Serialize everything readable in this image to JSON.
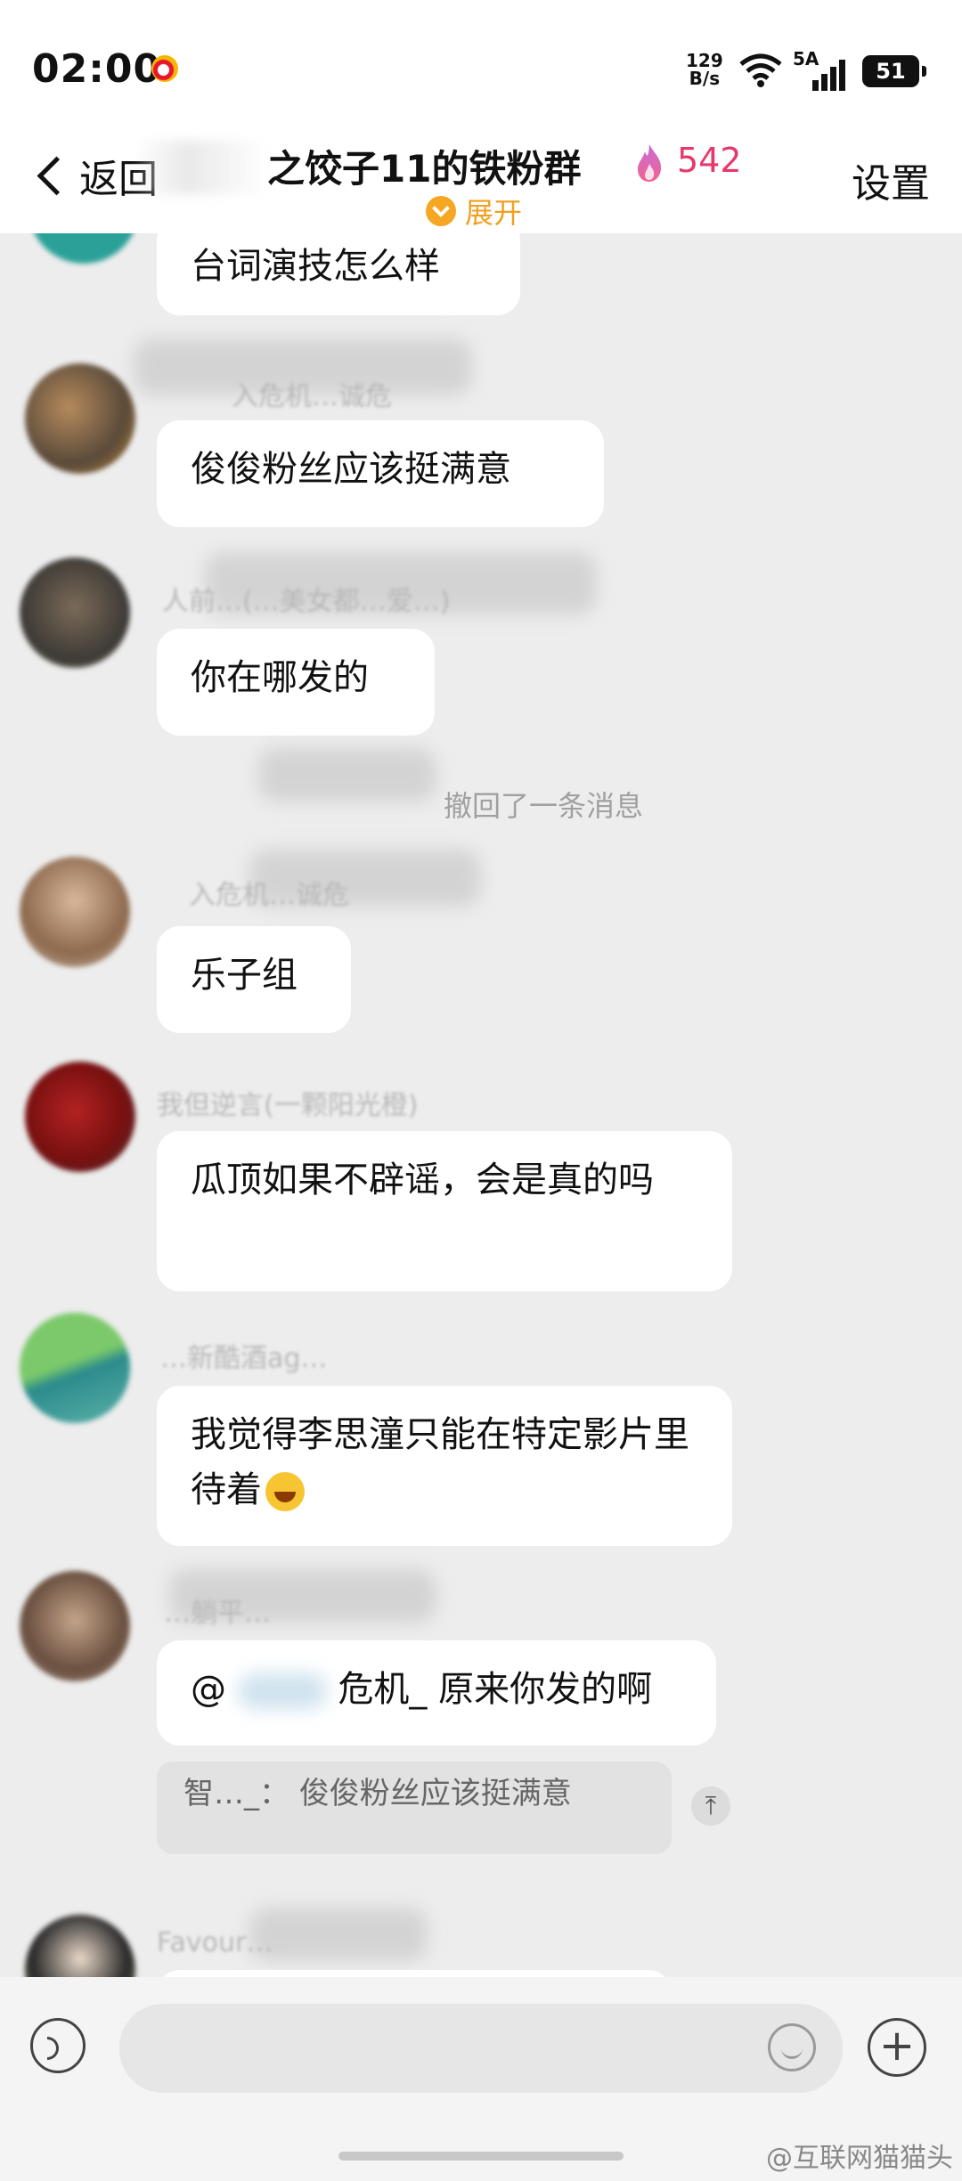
{
  "status": {
    "time": "02:00",
    "netspeed_top": "129",
    "netspeed_unit": "B/s",
    "network": "5A",
    "battery": "51"
  },
  "header": {
    "back_label": "返回",
    "title": "之饺子11的铁粉群",
    "member_count": "542",
    "expand_label": "展开",
    "settings_label": "设置"
  },
  "messages": [
    {
      "text": "台词演技怎么样"
    },
    {
      "name": "入危机…诚危",
      "text": "俊俊粉丝应该挺满意"
    },
    {
      "name": "人前…(…美女都…爱…)",
      "text": "你在哪发的"
    },
    {
      "notice": "撤回了一条消息"
    },
    {
      "name": "入危机…诚危",
      "text": "乐子组"
    },
    {
      "name": "我但逆言(一颗阳光橙)",
      "text": "瓜顶如果不辟谣，会是真的吗"
    },
    {
      "name": "…新酷酒ag…",
      "text": "我觉得李思潼只能在特定影片里待着"
    },
    {
      "name": "…躺平…",
      "mention": "@",
      "mention_rest": "危机_",
      "text": "原来你发的啊",
      "quote_author": "智…_：",
      "quote_text": "俊俊粉丝应该挺满意"
    },
    {
      "name": "Favour…"
    }
  ],
  "watermark": "@互联网猫猫头",
  "colors": {
    "accent_orange": "#f5a623",
    "count_red": "#e5396b",
    "background": "#ededed"
  },
  "icons": [
    "weibo-icon",
    "wifi-icon",
    "signal-icon",
    "battery-icon",
    "back-chevron-icon",
    "flame-icon",
    "chevron-down-icon",
    "voice-icon",
    "emoji-icon",
    "plus-icon",
    "laugh-emoji-icon"
  ]
}
